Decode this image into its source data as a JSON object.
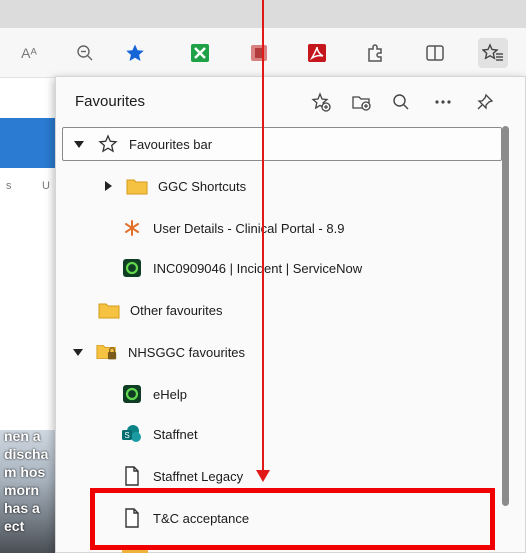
{
  "colors": {
    "accent_blue": "#2a7bd1",
    "highlight_red": "#f00000",
    "folder_yellow": "#f0b23a",
    "servicenow_green": "#1f7f3a"
  },
  "toolbar": {
    "buttons": [
      {
        "name": "read-aloud-button",
        "text": "Aᴬ"
      },
      {
        "name": "zoom-button",
        "icon": "zoom-out-icon"
      },
      {
        "name": "favourite-star-button",
        "icon": "star-filled-icon"
      },
      {
        "name": "excel-extension",
        "icon": "excel-icon"
      },
      {
        "name": "extension-2",
        "icon": "extension-icon"
      },
      {
        "name": "pdf-extension",
        "icon": "pdf-icon"
      },
      {
        "name": "extensions-button",
        "icon": "puzzle-icon"
      },
      {
        "name": "split-screen-button",
        "icon": "split-screen-icon"
      },
      {
        "name": "favourites-button",
        "icon": "favourites-icon"
      }
    ]
  },
  "page_background": {
    "tabs": [
      "s",
      "U"
    ],
    "photo_lines": [
      "nen a",
      "discha",
      "m hos",
      "morn",
      "has a",
      "ect"
    ]
  },
  "favourites": {
    "title": "Favourites",
    "actions": [
      {
        "name": "add-favourite-button",
        "icon": "star-plus-icon"
      },
      {
        "name": "add-folder-button",
        "icon": "folder-plus-icon"
      },
      {
        "name": "search-favourites-button",
        "icon": "search-icon"
      },
      {
        "name": "more-options-button",
        "icon": "more-icon"
      },
      {
        "name": "pin-button",
        "icon": "pin-icon"
      }
    ],
    "items": [
      {
        "label": "Favourites bar",
        "icon": "star-outline-icon",
        "caret": "down"
      },
      {
        "label": "GGC Shortcuts",
        "icon": "folder-icon",
        "caret": "right"
      },
      {
        "label": "User Details - Clinical Portal - 8.9",
        "icon": "clinical-portal-icon"
      },
      {
        "label": "INC0909046 | Incident | ServiceNow",
        "icon": "servicenow-icon"
      },
      {
        "label": "Other favourites",
        "icon": "folder-icon"
      },
      {
        "label": "NHSGGC favourites",
        "icon": "managed-folder-icon",
        "caret": "down"
      },
      {
        "label": "eHelp",
        "icon": "servicenow-icon"
      },
      {
        "label": "Staffnet",
        "icon": "sharepoint-icon"
      },
      {
        "label": "Staffnet Legacy",
        "icon": "page-icon"
      },
      {
        "label": "T&C acceptance",
        "icon": "page-icon"
      }
    ]
  }
}
